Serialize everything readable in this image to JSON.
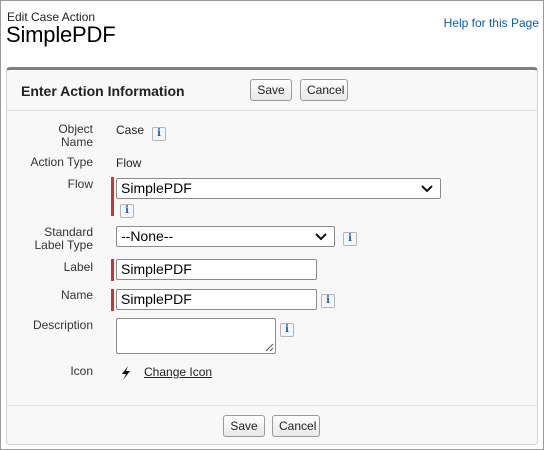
{
  "header": {
    "subtitle": "Edit Case Action",
    "title": "SimplePDF",
    "help_link": "Help for this Page"
  },
  "panel": {
    "title": "Enter Action Information",
    "save_label": "Save",
    "cancel_label": "Cancel"
  },
  "fields": {
    "object_name": {
      "label_line1": "Object",
      "label_line2": "Name",
      "value": "Case"
    },
    "action_type": {
      "label": "Action Type",
      "value": "Flow"
    },
    "flow": {
      "label": "Flow",
      "selected": "SimplePDF"
    },
    "standard_label_type": {
      "label_line1": "Standard",
      "label_line2": "Label Type",
      "selected": "--None--"
    },
    "label": {
      "label": "Label",
      "value": "SimplePDF"
    },
    "name": {
      "label": "Name",
      "value": "SimplePDF"
    },
    "description": {
      "label": "Description",
      "value": ""
    },
    "icon": {
      "label": "Icon",
      "change_link": "Change Icon",
      "icon_name": "lightning-bolt-icon"
    }
  },
  "info_icon": {
    "glyph": "i",
    "icon_name": "info-icon"
  },
  "colors": {
    "required_bar": "#c23934",
    "link": "#0b5cab",
    "panel_top_border": "#7f7f7f"
  }
}
